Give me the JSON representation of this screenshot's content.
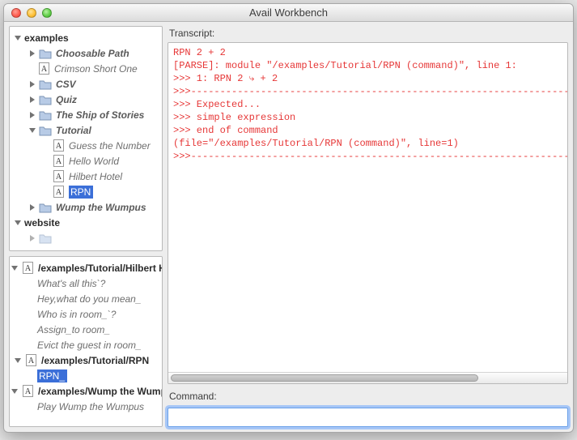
{
  "window": {
    "title": "Avail Workbench"
  },
  "tree": {
    "roots": [
      {
        "label": "examples",
        "open": true,
        "children": [
          {
            "label": "Choosable Path",
            "icon": "folder",
            "disclosure": "right"
          },
          {
            "label": "Crimson Short One",
            "icon": "a"
          },
          {
            "label": "CSV",
            "icon": "folder",
            "disclosure": "right"
          },
          {
            "label": "Quiz",
            "icon": "folder",
            "disclosure": "right"
          },
          {
            "label": "The Ship of Stories",
            "icon": "folder",
            "disclosure": "right"
          },
          {
            "label": "Tutorial",
            "icon": "folder",
            "disclosure": "down",
            "children": [
              {
                "label": "Guess the Number",
                "icon": "a"
              },
              {
                "label": "Hello World",
                "icon": "a"
              },
              {
                "label": "Hilbert Hotel",
                "icon": "a"
              },
              {
                "label": "RPN",
                "icon": "a",
                "selected": true
              }
            ]
          },
          {
            "label": "Wump the Wumpus",
            "icon": "folder",
            "disclosure": "right"
          }
        ]
      },
      {
        "label": "website",
        "open": true,
        "children": [
          {
            "label": "",
            "icon": "folder",
            "disclosure": "right",
            "partial": true
          }
        ]
      }
    ]
  },
  "entries": [
    {
      "header": "/examples/Tutorial/Hilbert Hotel",
      "items": [
        "What's all this`?",
        "Hey,what do you mean_",
        "Who is in room_`?",
        "Assign_to room_",
        "Evict the guest in room_"
      ]
    },
    {
      "header": "/examples/Tutorial/RPN",
      "items_sel": "RPN_"
    },
    {
      "header": "/examples/Wump the Wumpus",
      "items": [
        "Play Wump the Wumpus"
      ]
    }
  ],
  "transcript": {
    "label": "Transcript:",
    "lines": [
      "RPN 2 + 2",
      "[PARSE]: module \"/examples/Tutorial/RPN (command)\", line 1:",
      ">>> 1: RPN 2 ⤷ + 2",
      ">>>---------------------------------------------------------------------",
      ">>> Expected...",
      ">>> simple expression",
      ">>> end of command",
      "(file=\"/examples/Tutorial/RPN (command)\", line=1)",
      ">>>---------------------------------------------------------------------"
    ]
  },
  "command": {
    "label": "Command:",
    "value": ""
  }
}
